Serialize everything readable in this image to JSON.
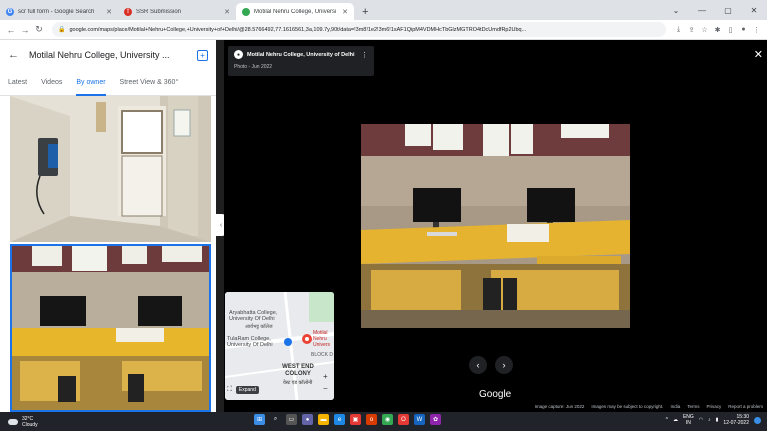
{
  "browser": {
    "tabs": [
      {
        "title": "scr full form - Google Search",
        "favicon": "google-icon",
        "color": "#4285f4",
        "glyph": "G",
        "active": false
      },
      {
        "title": "SSR Submission",
        "favicon": "ssr-icon",
        "color": "#d93025",
        "glyph": "!",
        "active": false
      },
      {
        "title": "Motilal Nehru College, Universi",
        "favicon": "maps-pin-icon",
        "color": "#34a853",
        "glyph": "●",
        "active": true
      }
    ],
    "new_tab": "+",
    "url": "google.com/maps/place/Motilal+Nehru+College,+University+of+Delhi/@28.5766492,77.1616561,3a,109.7y,90t/data=!3m8!1e2!3m6!1sAF1QipM4VDMHcTbGlzMGTRO4tDcUmdfRp2Ubq..."
  },
  "left_panel": {
    "place_name": "Motilal Nehru College, University ...",
    "tabs": [
      "Latest",
      "Videos",
      "By owner",
      "Street View & 360°"
    ],
    "active_tab": "By owner"
  },
  "viewer": {
    "owner_name": "Motilal Nehru College, University of Delhi",
    "photo_date": "Photo - Jun 2022",
    "minimap": {
      "label_aryabhatta": "Aryabhatta College, University Of Delhi",
      "label_aryabhatta_hindi": "आर्यभट्ट कॉलेज",
      "label_motilal": "Motilal Nehru Univers",
      "label_tularam": "TulaRam College, University Of Delhi",
      "label_block": "BLOCK D",
      "label_westend": "WEST END COLONY",
      "label_westend_hindi": "वेस्ट एंड कॉलोनी",
      "expand_label": "Expand"
    },
    "google_logo": "Google",
    "footer": [
      "Image capture: Jun 2022",
      "Images may be subject to copyright.",
      "India",
      "Terms",
      "Privacy",
      "Report a problem"
    ]
  },
  "taskbar": {
    "temperature": "32°C",
    "condition": "Cloudy",
    "lang": "ENG",
    "lang_region": "IN",
    "time": "15:30",
    "date": "12-07-2022"
  }
}
